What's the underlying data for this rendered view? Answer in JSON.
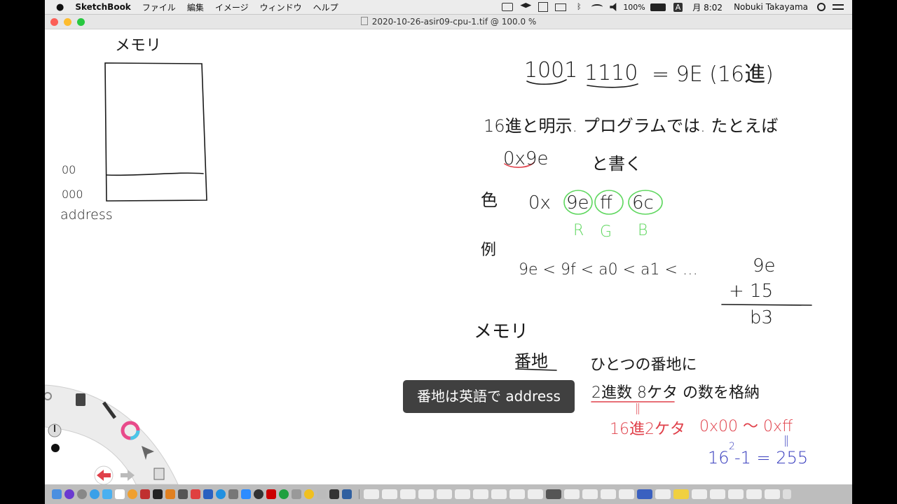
{
  "menubar": {
    "app_name": "SketchBook",
    "menus": [
      "ファイル",
      "編集",
      "イメージ",
      "ウィンドウ",
      "ヘルプ"
    ],
    "battery": "100%",
    "input_mode": "A",
    "clock": "月 8:02",
    "user": "Nobuki Takayama"
  },
  "window": {
    "title": "2020-10-26-asir09-cpu-1.tif @ 100.0 %"
  },
  "notes": {
    "memory_label_top": "メモリ",
    "addr_1": "00",
    "addr_2": "000",
    "address": "address",
    "binary_left": "1001",
    "binary_right": "1110",
    "hex_eq": "= 9E (16進)",
    "line2": "16進と明示. プログラムでは. たとえば",
    "line3a": "0x9e",
    "line3b": "と書く",
    "color_label": "色",
    "color_prefix": "0x",
    "color_r": "9e",
    "color_g": "ff",
    "color_b": "6c",
    "letter_r": "R",
    "letter_g": "G",
    "letter_b": "B",
    "example_label": "例",
    "example_seq": "9e < 9f < a0 < a1 < …",
    "add_top": "9e",
    "add_mid": "+ 15",
    "add_res": "b3",
    "memory_label_2": "メモリ",
    "banchi": "番地",
    "banchi_desc": "ひとつの番地に",
    "store_a": "2進数 8ケタ",
    "store_b": "の数を格納",
    "eq_mark": "‖",
    "hex2": "16進2ケタ",
    "range": "0x00 ～ 0xff",
    "eq_mark2": "‖",
    "formula_base": "16",
    "formula_exp": "2",
    "formula_rest": "-1 = 255"
  },
  "subtitle": "番地は英語で address",
  "colors": {
    "ink": "#1a1a1a",
    "green": "#5ed75e",
    "red": "#e0404a",
    "blue": "#3a3fbf"
  }
}
